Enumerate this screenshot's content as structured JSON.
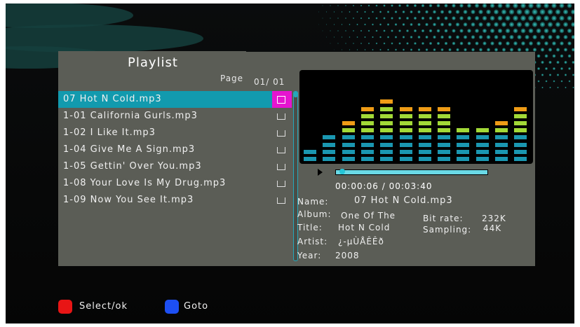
{
  "playlist": {
    "title": "Playlist",
    "page_label": "Page",
    "page_value": "01/ 01",
    "items": [
      {
        "label": "07 Hot N Cold.mp3",
        "selected": true
      },
      {
        "label": "1-01 California Gurls.mp3",
        "selected": false
      },
      {
        "label": "1-02 I Like It.mp3",
        "selected": false
      },
      {
        "label": "1-04 Give Me A Sign.mp3",
        "selected": false
      },
      {
        "label": "1-05 Gettin' Over You.mp3",
        "selected": false
      },
      {
        "label": "1-08 Your Love Is My Drug.mp3",
        "selected": false
      },
      {
        "label": "1-09 Now You See It.mp3",
        "selected": false
      }
    ]
  },
  "player": {
    "time": "00:00:06 / 00:03:40",
    "progress": 0.03,
    "equalizer_levels": [
      2,
      4,
      6,
      8,
      9,
      8,
      8,
      8,
      5,
      5,
      6,
      8
    ],
    "colors": {
      "low": "#1a97b1",
      "mid": "#a2d937",
      "high": "#ef9c16"
    }
  },
  "info": {
    "name_label": "Name:",
    "name_value": "07 Hot N Cold.mp3",
    "album_label": "Album:",
    "album_value": "One Of The",
    "title_label": "Title:",
    "title_value": "Hot N Cold",
    "artist_label": "Artist:",
    "artist_value": "¿-µÙÅÊÊð",
    "year_label": "Year:",
    "year_value": "2008",
    "bitrate_label": "Bit rate:",
    "bitrate_value": "232K",
    "sampling_label": "Sampling:",
    "sampling_value": "44K"
  },
  "footer": {
    "select_label": "Select/ok",
    "goto_label": "Goto"
  }
}
